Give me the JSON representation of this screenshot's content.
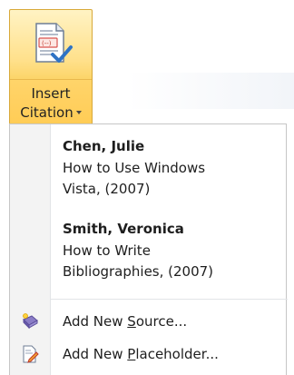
{
  "ribbon_button": {
    "line1": "Insert",
    "line2": "Citation",
    "icon": "insert-citation-icon"
  },
  "menu": {
    "citations": [
      {
        "author": "Chen, Julie",
        "title_lines": [
          "How to Use Windows",
          "Vista, (2007)"
        ]
      },
      {
        "author": "Smith, Veronica",
        "title_lines": [
          "How to Write",
          "Bibliographies, (2007)"
        ]
      }
    ],
    "commands": [
      {
        "pre": "Add New ",
        "accel": "S",
        "post": "ource...",
        "icon": "add-source-icon"
      },
      {
        "pre": "Add New ",
        "accel": "P",
        "post": "laceholder...",
        "icon": "add-placeholder-icon"
      }
    ]
  },
  "colors": {
    "button_border": "#d8a93a",
    "button_highlight": "#ffcc55",
    "menu_border": "#c6c6c6",
    "gutter": "#f3f3f3"
  }
}
